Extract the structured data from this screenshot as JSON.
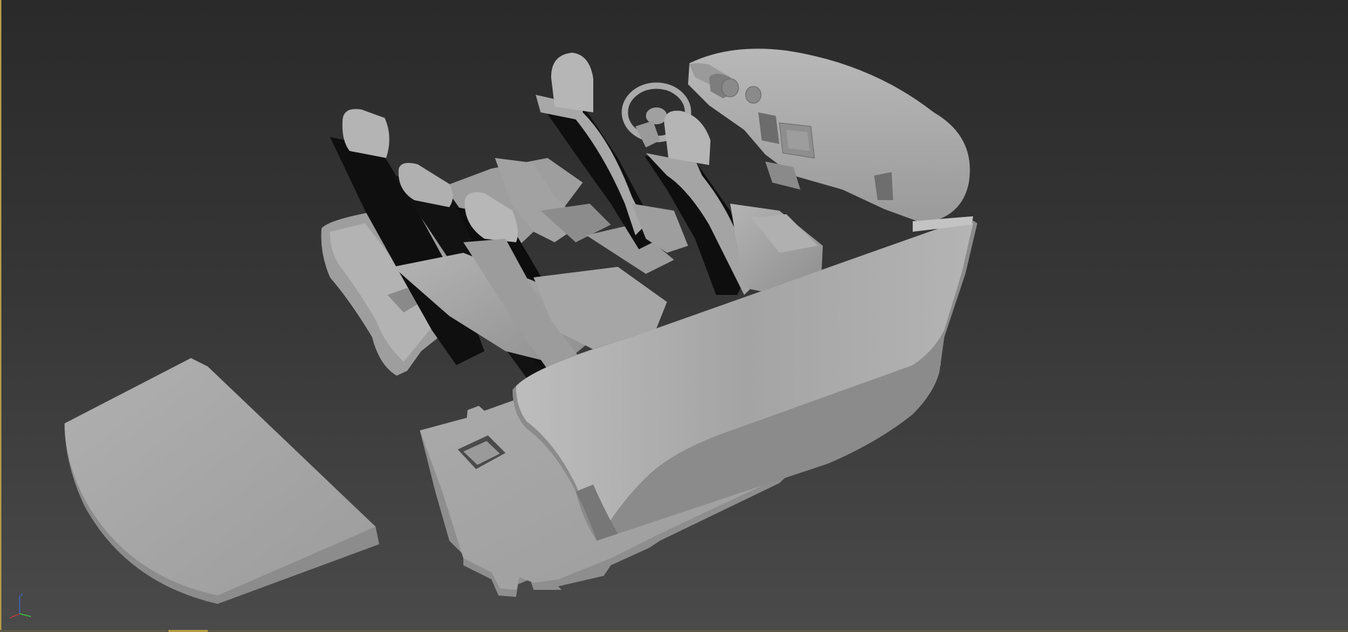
{
  "viewport": {
    "background_top": "#2a2a2a",
    "background_bottom": "#4a4a4a",
    "border_accent": "#b59a46",
    "model_color": "#a9a9a9",
    "model_shadow": "#8a8a8a",
    "model_highlight": "#c6c6c6",
    "seat_back_dark": "#0e0e0e"
  },
  "scene": {
    "objects": [
      "rear-parcel-shelf",
      "floor-panel",
      "rear-bench-seat",
      "center-console",
      "driver-seat",
      "passenger-seat",
      "steering-wheel",
      "dashboard",
      "right-door-panel"
    ]
  },
  "axis_gizmo": {
    "x_color": "#d23a3a",
    "y_color": "#3ad23a",
    "z_color": "#3a6ad2",
    "z_label": "z"
  }
}
